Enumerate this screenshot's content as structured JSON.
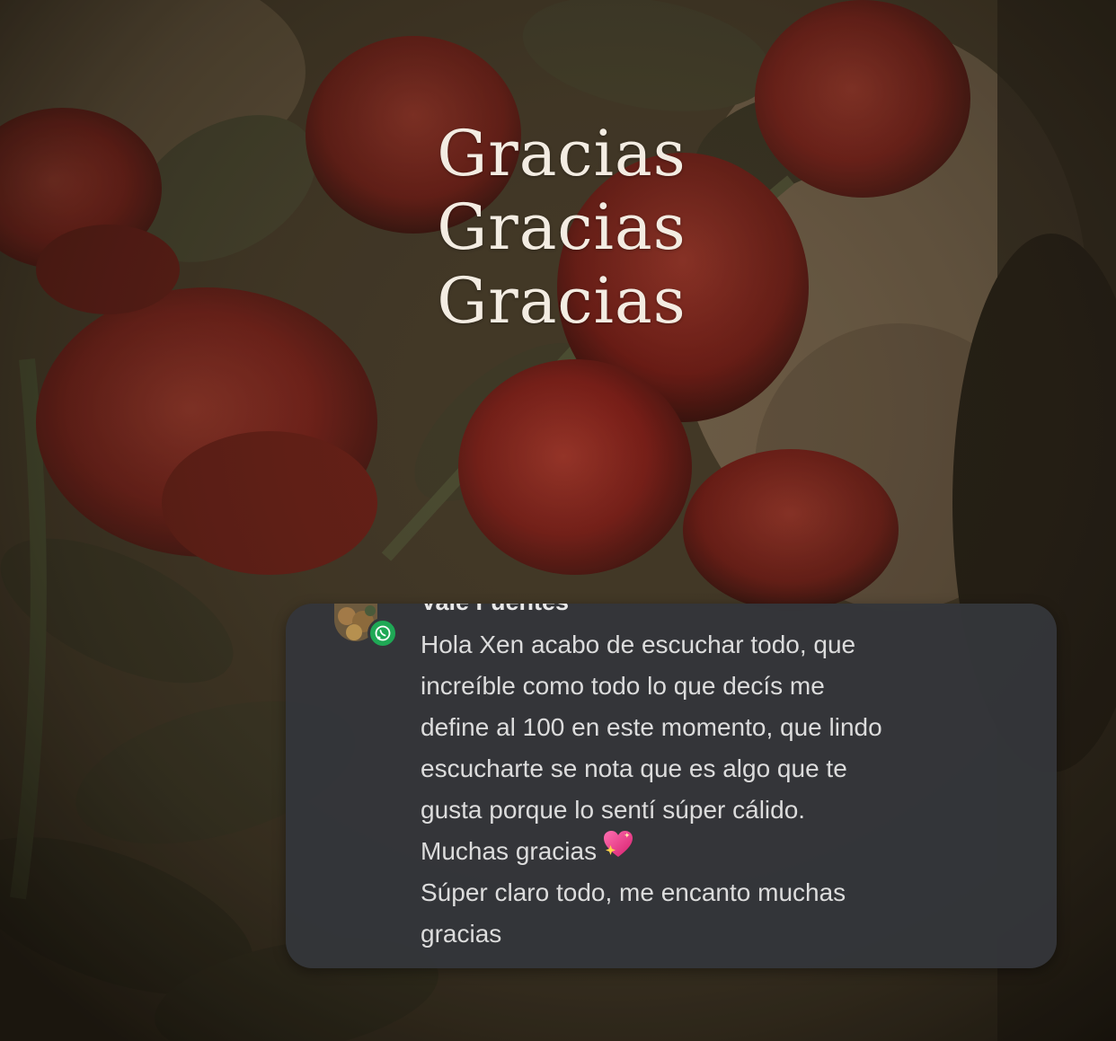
{
  "background": {
    "description_icon": "red-roses-photo-icon",
    "colors": {
      "base": "#4a3f2c",
      "leaf": "#3f3b28",
      "rose": "#8a1f1a",
      "rose_light": "#a8362b",
      "skin": "#7d6a52"
    }
  },
  "title": {
    "lines": [
      "Gracias",
      "Gracias",
      "Gracias"
    ]
  },
  "notification": {
    "app_icon": "whatsapp-icon",
    "sender": "Vale Fuentes",
    "time": "",
    "message_lines": [
      "Hola Xen acabo de escuchar todo, que",
      "increíble como todo lo que decís me",
      "define al 100 en este momento, que lindo",
      "escucharte se nota que es algo que te",
      "gusta porque lo sentí súper cálido.",
      "Muchas gracias",
      "Súper claro todo, me encanto muchas",
      "gracias"
    ],
    "emoji_icon": "sparkling-heart-icon",
    "colors": {
      "card": "#34363a",
      "text": "#dcdcdc",
      "badge": "#1fa855"
    }
  }
}
